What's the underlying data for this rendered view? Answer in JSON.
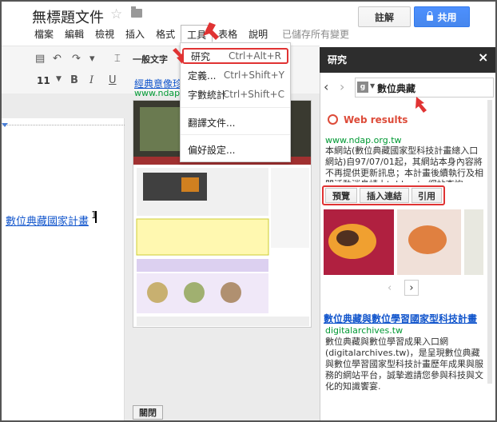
{
  "doc": {
    "title": "無標題文件",
    "comments_label": "註解",
    "share_label": "共用",
    "saved_status": "已儲存所有變更"
  },
  "menu": [
    "檔案",
    "編輯",
    "檢視",
    "插入",
    "格式",
    "工具",
    "表格",
    "說明"
  ],
  "toolbar": {
    "font": "一般文字",
    "font_size": "11"
  },
  "tools_menu": {
    "research": {
      "label": "研究",
      "shortcut": "Ctrl+Alt+R"
    },
    "define": {
      "label": "定義...",
      "shortcut": "Ctrl+Shift+Y"
    },
    "word_count": {
      "label": "字數統計",
      "shortcut": "Ctrl+Shift+C"
    },
    "translate": {
      "label": "翻譯文件..."
    },
    "prefs": {
      "label": "偏好設定..."
    }
  },
  "document": {
    "link_text": "數位典藏國家計畫",
    "superscript": "1"
  },
  "preview": {
    "title": "經典意像珍",
    "url": "www.ndap.",
    "close_label": "關閉"
  },
  "research": {
    "title": "研究",
    "close": "×",
    "query": "數位典藏",
    "engine_letter": "g",
    "web_results": "Web results",
    "result1": {
      "url": "www.ndap.org.tw",
      "snippet": "本網站(數位典藏國家型科技計畫總入口網站)自97/07/01起，其網站本身內容將不再提供更新訊息；本計畫後續執行及相關活動消息請上teldap.tw網站查詢"
    },
    "actions": {
      "preview": "預覽",
      "insert_link": "插入連結",
      "cite": "引用"
    },
    "result2": {
      "title": "數位典藏與數位學習國家型科技計畫",
      "url": "digitalarchives.tw",
      "snippet": "數位典藏與數位學習成果入口網(digitalarchives.tw)，是呈現數位典藏與數位學習國家型科技計畫歷年成果與服務的網站平台，誠摯邀請您參與科技與文化的知識饗宴."
    }
  },
  "colors": {
    "accent": "#4d90fe",
    "highlight": "#e03333",
    "link": "#1155cc",
    "url": "#009933"
  }
}
